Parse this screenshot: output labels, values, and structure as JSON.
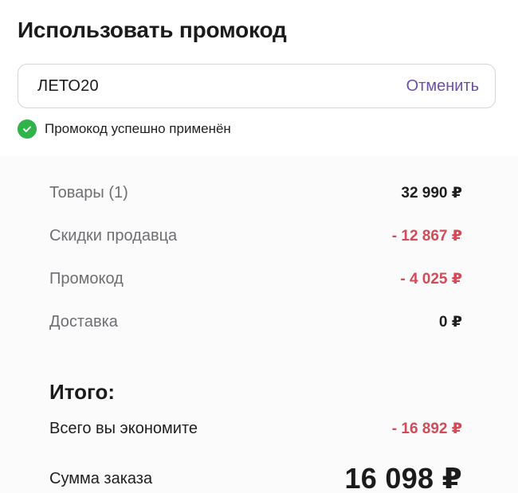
{
  "title": "Использовать промокод",
  "promo": {
    "value": "ЛЕТО20",
    "cancel_label": "Отменить"
  },
  "status": {
    "message": "Промокод успешно применён",
    "icon": "check-circle-icon",
    "color": "#2fb34a"
  },
  "summary": {
    "items": [
      {
        "label": "Товары (1)",
        "value": "32 990 ₽",
        "type": "normal"
      },
      {
        "label": "Скидки продавца",
        "value": "- 12 867 ₽",
        "type": "negative"
      },
      {
        "label": "Промокод",
        "value": "- 4 025 ₽",
        "type": "negative"
      },
      {
        "label": "Доставка",
        "value": "0 ₽",
        "type": "normal"
      }
    ],
    "total_heading": "Итого:",
    "savings_label": "Всего вы экономите",
    "savings_value": "- 16 892 ₽",
    "order_label": "Сумма заказа",
    "order_value": "16 098 ₽"
  },
  "colors": {
    "accent": "#6b4fa8",
    "negative": "#d24b57",
    "success": "#2fb34a"
  }
}
